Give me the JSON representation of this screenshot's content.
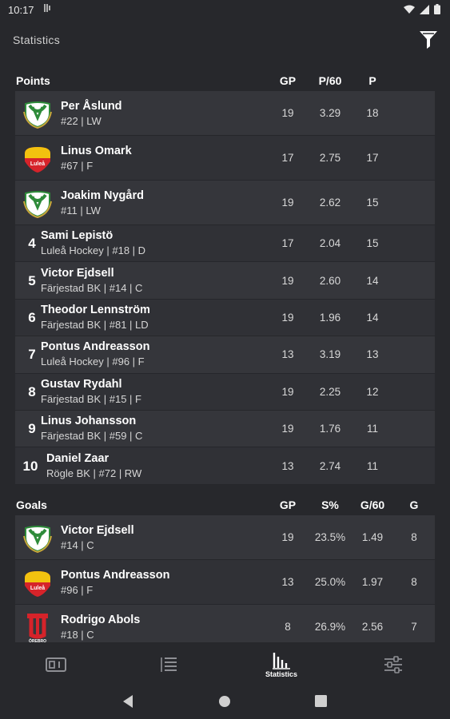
{
  "status": {
    "time": "10:17",
    "mini": "⁠฿"
  },
  "header": {
    "title": "Statistics"
  },
  "points": {
    "title": "Points",
    "columns": [
      "GP",
      "P/60",
      "P"
    ],
    "rows": [
      {
        "rank": "",
        "logo": "farjestad-logo",
        "name": "Per Åslund",
        "sub": "#22 | LW",
        "gp": "19",
        "rate": "3.29",
        "val": "18"
      },
      {
        "rank": "",
        "logo": "lulea-logo",
        "name": "Linus Omark",
        "sub": "#67 | F",
        "gp": "17",
        "rate": "2.75",
        "val": "17"
      },
      {
        "rank": "",
        "logo": "farjestad-logo",
        "name": "Joakim Nygård",
        "sub": "#11 | LW",
        "gp": "19",
        "rate": "2.62",
        "val": "15"
      },
      {
        "rank": "4",
        "name": "Sami Lepistö",
        "sub": "Luleå Hockey | #18 | D",
        "gp": "17",
        "rate": "2.04",
        "val": "15"
      },
      {
        "rank": "5",
        "name": "Victor Ejdsell",
        "sub": "Färjestad BK | #14 | C",
        "gp": "19",
        "rate": "2.60",
        "val": "14"
      },
      {
        "rank": "6",
        "name": "Theodor Lennström",
        "sub": "Färjestad BK | #81 | LD",
        "gp": "19",
        "rate": "1.96",
        "val": "14"
      },
      {
        "rank": "7",
        "name": "Pontus Andreasson",
        "sub": "Luleå Hockey | #96 | F",
        "gp": "13",
        "rate": "3.19",
        "val": "13"
      },
      {
        "rank": "8",
        "name": "Gustav Rydahl",
        "sub": "Färjestad BK | #15 | F",
        "gp": "19",
        "rate": "2.25",
        "val": "12"
      },
      {
        "rank": "9",
        "name": "Linus Johansson",
        "sub": "Färjestad BK | #59 | C",
        "gp": "19",
        "rate": "1.76",
        "val": "11"
      },
      {
        "rank": "10",
        "name": "Daniel Zaar",
        "sub": "Rögle BK | #72 | RW",
        "gp": "13",
        "rate": "2.74",
        "val": "11"
      }
    ]
  },
  "goals": {
    "title": "Goals",
    "columns": [
      "GP",
      "S%",
      "G/60",
      "G"
    ],
    "rows": [
      {
        "logo": "farjestad-logo",
        "name": "Victor Ejdsell",
        "sub": "#14 | C",
        "gp": "19",
        "pct": "23.5%",
        "rate": "1.49",
        "val": "8"
      },
      {
        "logo": "lulea-logo",
        "name": "Pontus Andreasson",
        "sub": "#96 | F",
        "gp": "13",
        "pct": "25.0%",
        "rate": "1.97",
        "val": "8"
      },
      {
        "logo": "orebro-logo",
        "name": "Rodrigo Abols",
        "sub": "#18 | C",
        "gp": "8",
        "pct": "26.9%",
        "rate": "2.56",
        "val": "7"
      }
    ]
  },
  "logos": {
    "lulea_text": "Luleå",
    "orebro_text": "ÖREBRO"
  },
  "nav": {
    "items": [
      {
        "icon": "scoreboard-icon",
        "label": ""
      },
      {
        "icon": "standings-icon",
        "label": ""
      },
      {
        "icon": "statistics-icon",
        "label": "Statistics"
      },
      {
        "icon": "settings-sliders-icon",
        "label": ""
      }
    ]
  },
  "colors": {
    "background": "#27282c",
    "row_a": "#35363b",
    "row_b": "#303136",
    "farjestad_green": "#2e8b3a",
    "lulea_yellow": "#f2c20f",
    "lulea_red": "#d6232a",
    "orebro_red": "#d6232a"
  }
}
